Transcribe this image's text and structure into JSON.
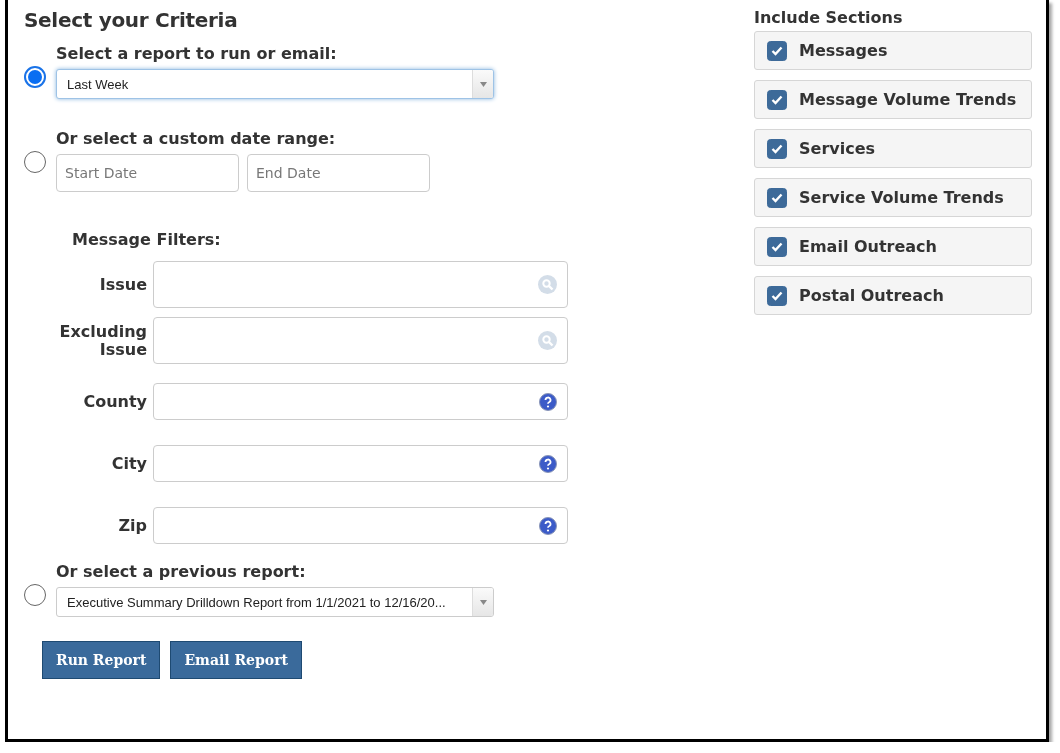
{
  "title": "Select your Criteria",
  "options": [
    {
      "kind": "select",
      "label": "Select a report to run or email:",
      "selected": true,
      "value": "Last Week",
      "focused": true
    },
    {
      "kind": "daterange",
      "label": "Or select a custom date range:",
      "selected": false,
      "start_placeholder": "Start Date",
      "end_placeholder": "End Date"
    },
    {
      "kind": "filters",
      "title": "Message Filters:",
      "filters": [
        {
          "label": "Issue",
          "kind": "search",
          "tall": true
        },
        {
          "label": "Excluding Issue",
          "kind": "search",
          "tall": true
        },
        {
          "label": "County",
          "kind": "help",
          "tall": false
        },
        {
          "label": "City",
          "kind": "help",
          "tall": false
        },
        {
          "label": "Zip",
          "kind": "help",
          "tall": false
        }
      ]
    },
    {
      "kind": "select",
      "label": "Or select a previous report:",
      "selected": false,
      "value": "Executive Summary Drilldown Report from 1/1/2021 to 12/16/20...",
      "focused": false
    }
  ],
  "buttons": [
    "Run Report",
    "Email Report"
  ],
  "sections": {
    "title": "Include Sections",
    "items": [
      {
        "label": "Messages",
        "checked": true
      },
      {
        "label": "Message Volume Trends",
        "checked": true
      },
      {
        "label": "Services",
        "checked": true
      },
      {
        "label": "Service Volume Trends",
        "checked": true
      },
      {
        "label": "Email Outreach",
        "checked": true
      },
      {
        "label": "Postal Outreach",
        "checked": true
      }
    ]
  }
}
